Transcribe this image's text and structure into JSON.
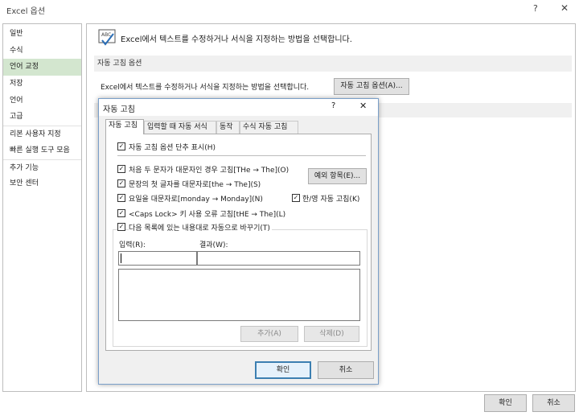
{
  "window": {
    "title": "Excel 옵션",
    "help": "?",
    "close": "✕"
  },
  "sidebar": {
    "items": [
      {
        "label": "일반"
      },
      {
        "label": "수식"
      },
      {
        "label": "언어 교정"
      },
      {
        "label": "저장"
      },
      {
        "label": "언어"
      },
      {
        "label": "고급"
      },
      {
        "label": "리본 사용자 지정"
      },
      {
        "label": "빠른 실행 도구 모음"
      },
      {
        "label": "추가 기능"
      },
      {
        "label": "보안 센터"
      }
    ],
    "selected": "언어 교정"
  },
  "content": {
    "header_text": "Excel에서 텍스트를 수정하거나 서식을 지정하는 방법을 선택합니다.",
    "section_title": "자동 고침 옵션",
    "ac_line": "Excel에서 텍스트를 수정하거나 서식을 지정하는 방법을 선택합니다.",
    "ac_options_button": "자동 고침 옵션(A)...",
    "icon_text": "ABC"
  },
  "footer": {
    "ok": "확인",
    "cancel": "취소"
  },
  "dialog": {
    "title": "자동 고침",
    "help": "?",
    "close": "✕",
    "tabs": [
      {
        "label": "자동 고침"
      },
      {
        "label": "입력할 때 자동 서식"
      },
      {
        "label": "동작"
      },
      {
        "label": "수식 자동 고침"
      }
    ],
    "active_tab": "자동 고침",
    "checkboxes": {
      "show_buttons": {
        "label": "자동 고침 옵션 단추 표시(H)",
        "checked": true
      },
      "two_initials": {
        "label": "처음 두 문자가 대문자인 경우 고침[THe → The](O)",
        "checked": true
      },
      "first_letter": {
        "label": "문장의 첫 글자를 대문자로[the → The](S)",
        "checked": true
      },
      "day_names": {
        "label": "요일을 대문자로[monday → Monday](N)",
        "checked": true
      },
      "caps_lock": {
        "label": "<Caps Lock> 키 사용 오류 고침[tHE → The](L)",
        "checked": true
      },
      "replace_text": {
        "label": "다음 목록에 있는 내용대로 자동으로 바꾸기(T)",
        "checked": true
      },
      "han_eng": {
        "label": "한/영 자동 고침(K)",
        "checked": true
      }
    },
    "exceptions_button": "예외 항목(E)...",
    "replace_label": "입력(R):",
    "with_label": "결과(W):",
    "replace_value": "",
    "with_value": "",
    "add_button": "추가(A)",
    "delete_button": "삭제(D)",
    "ok": "확인",
    "cancel": "취소",
    "check_mark": "✓"
  }
}
